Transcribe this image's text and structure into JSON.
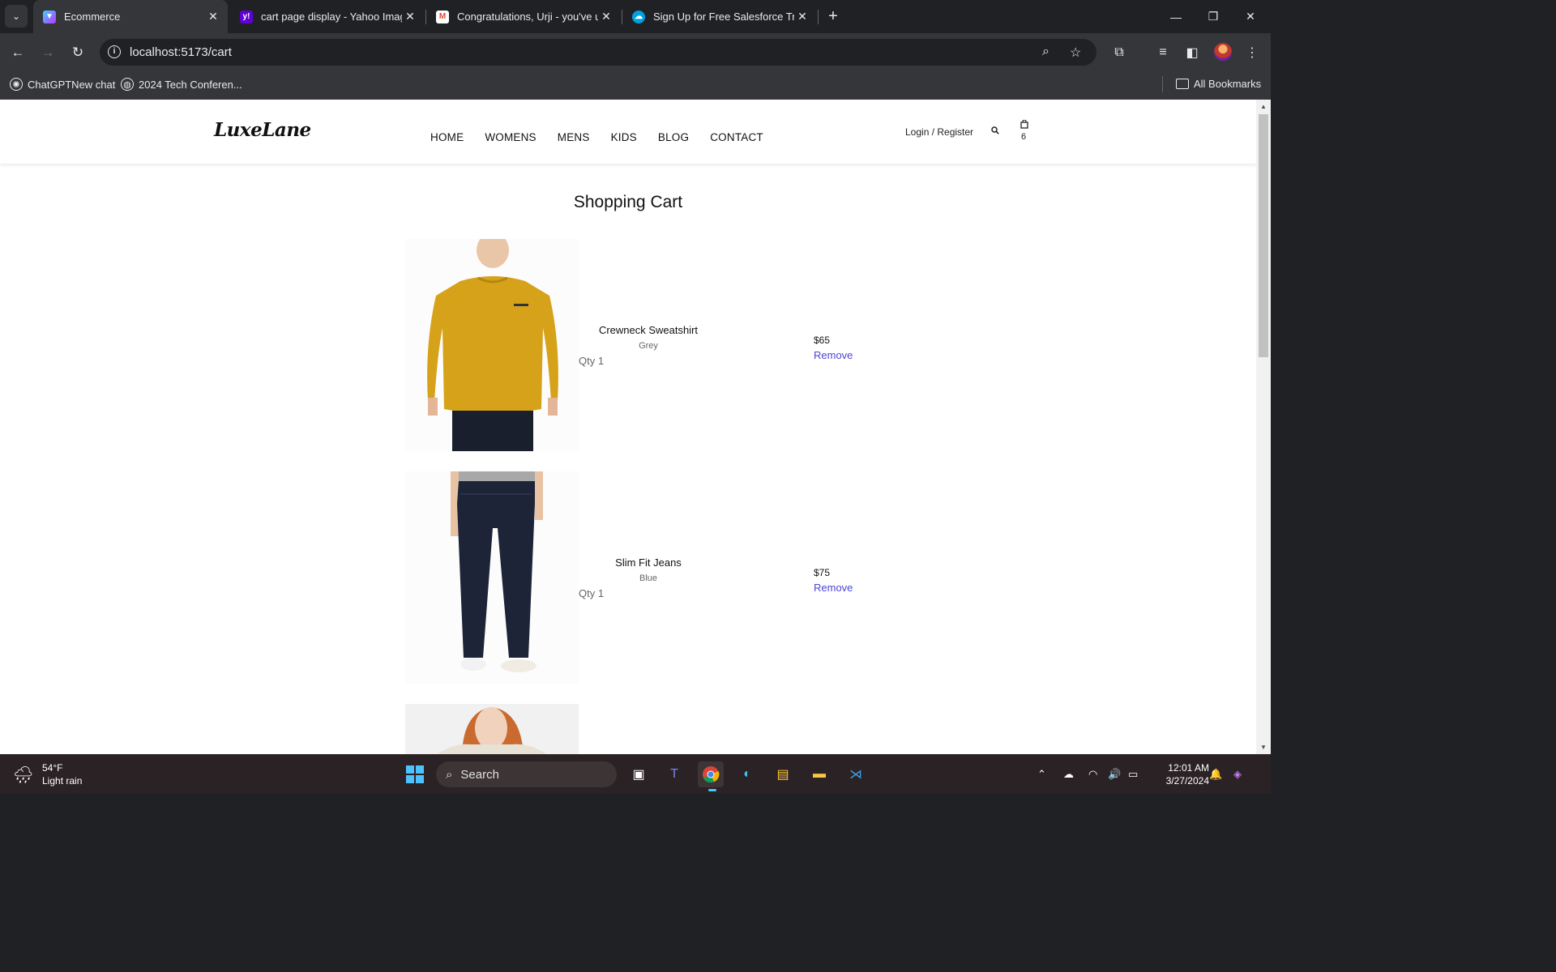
{
  "browser": {
    "tabs": [
      {
        "title": "Ecommerce",
        "favicon": "vite-icon",
        "active": true
      },
      {
        "title": "cart page display - Yahoo Image Search",
        "favicon": "yahoo-icon",
        "active": false
      },
      {
        "title": "Congratulations, Urji - you've unlocked",
        "favicon": "gmail-icon",
        "active": false
      },
      {
        "title": "Sign Up for Free Salesforce Trailhead",
        "favicon": "salesforce-icon",
        "active": false
      }
    ],
    "url": "localhost:5173/cart",
    "bookmarks": [
      {
        "label": "ChatGPTNew chat",
        "icon": "chatgpt-icon"
      },
      {
        "label": "2024 Tech Conferen...",
        "icon": "globe-icon"
      }
    ],
    "all_bookmarks_label": "All Bookmarks"
  },
  "site": {
    "logo": "LuxeLane",
    "nav": [
      "HOME",
      "WOMENS",
      "MENS",
      "KIDS",
      "BLOG",
      "CONTACT"
    ],
    "login_label": "Login / Register",
    "cart_count": "6"
  },
  "cart": {
    "title": "Shopping Cart",
    "items": [
      {
        "name": "Crewneck Sweatshirt",
        "color": "Grey",
        "qty": "Qty 1",
        "price": "$65",
        "remove_label": "Remove"
      },
      {
        "name": "Slim Fit Jeans",
        "color": "Blue",
        "qty": "Qty 1",
        "price": "$75",
        "remove_label": "Remove"
      }
    ]
  },
  "taskbar": {
    "weather_temp": "54°F",
    "weather_desc": "Light rain",
    "search_label": "Search",
    "time": "12:01 AM",
    "date": "3/27/2024"
  },
  "colors": {
    "remove_link": "#4b46d3",
    "chrome_dark": "#202124",
    "chrome_toolbar": "#35363a"
  }
}
